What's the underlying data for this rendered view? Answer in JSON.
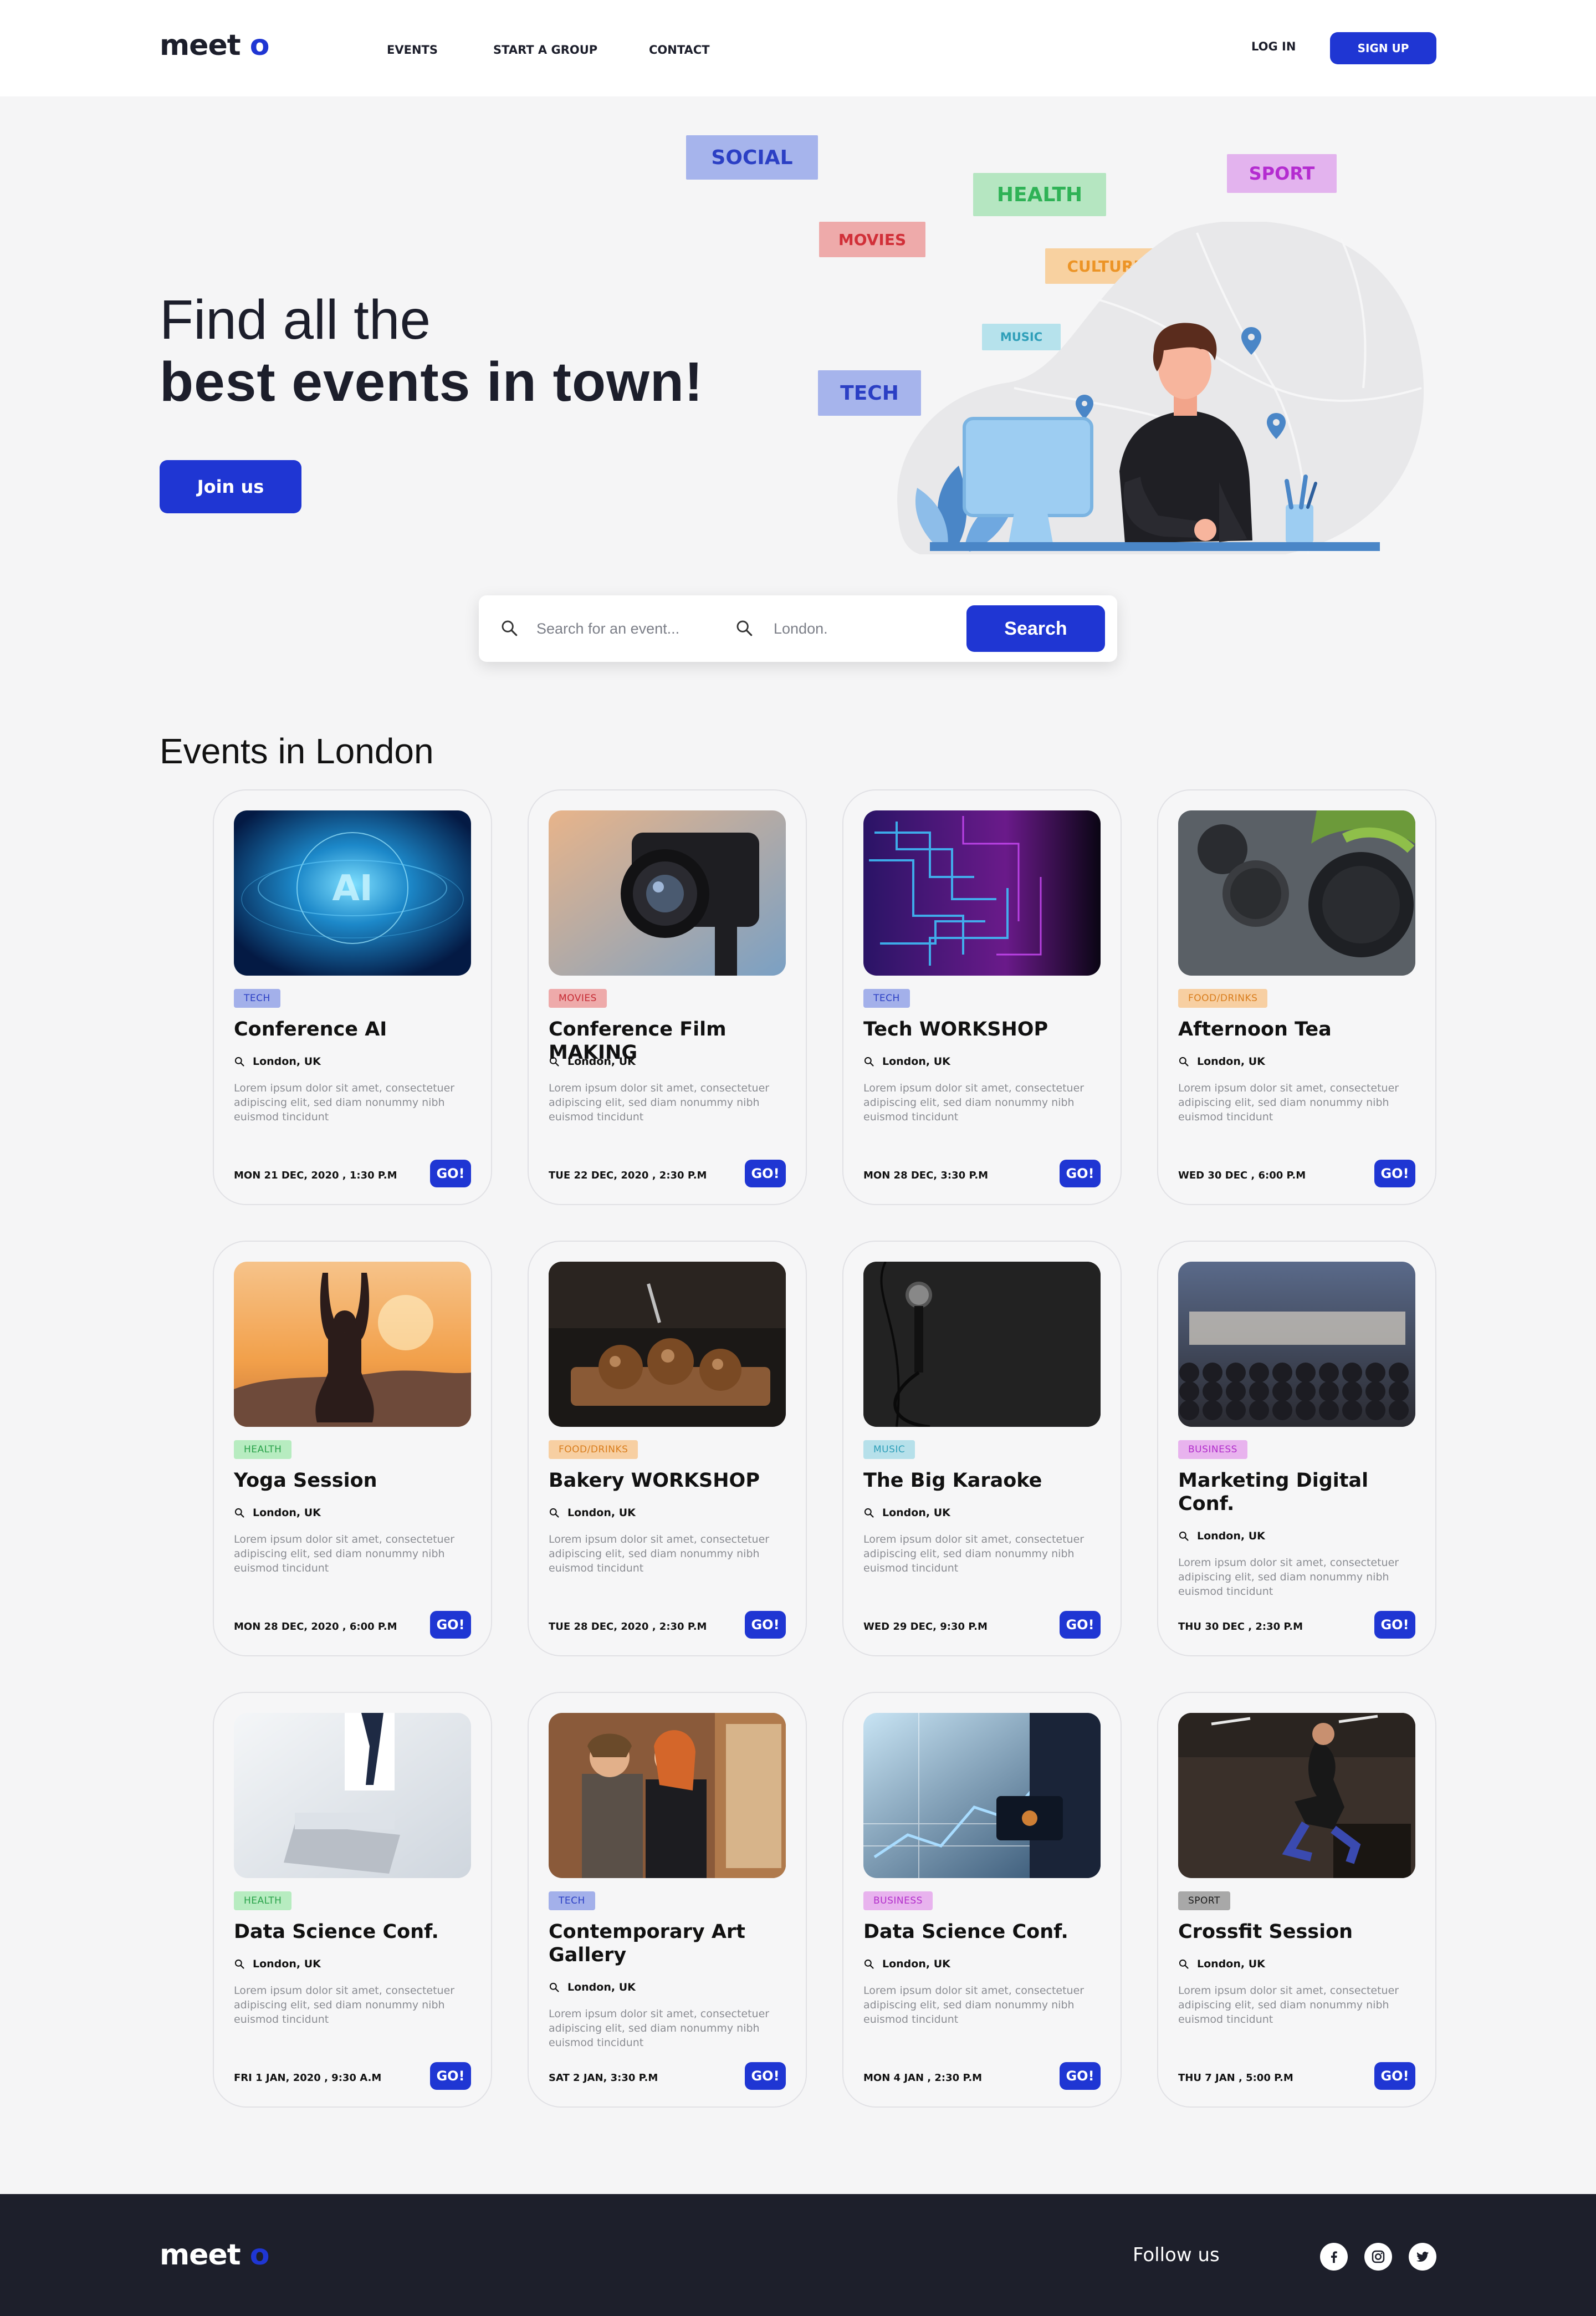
{
  "header": {
    "logo_text": "meet",
    "logo_accent": "o",
    "nav": [
      "EVENTS",
      "START A GROUP",
      "CONTACT"
    ],
    "login_label": "LOG IN",
    "signup_label": "SIGN UP"
  },
  "hero": {
    "line1": "Find all the",
    "line2": "best events in town!",
    "cta_label": "Join us",
    "floating_tags": [
      "SOCIAL",
      "HEALTH",
      "SPORT",
      "MOVIES",
      "CULTURE",
      "MUSIC",
      "TECH"
    ]
  },
  "search": {
    "event_placeholder": "Search for an event...",
    "location_placeholder": "London.",
    "button_label": "Search"
  },
  "events_title": "Events in London",
  "events": [
    {
      "tag": "TECH",
      "title": "Conference AI",
      "location": "London, UK",
      "description": "Lorem ipsum dolor sit amet, consectetuer adipiscing elit, sed diam nonummy nibh euismod tincidunt",
      "date": "MON 21 DEC, 2020 , 1:30 P.M",
      "go_label": "GO!"
    },
    {
      "tag": "MOVIES",
      "title": "Conference Film MAKING",
      "location": "London, UK",
      "description": "Lorem ipsum dolor sit amet, consectetuer adipiscing elit, sed diam nonummy nibh euismod tincidunt",
      "date": "TUE 22 DEC, 2020 , 2:30 P.M",
      "go_label": "GO!"
    },
    {
      "tag": "TECH",
      "title": "Tech WORKSHOP",
      "location": "London, UK",
      "description": "Lorem ipsum dolor sit amet, consectetuer adipiscing elit, sed diam nonummy nibh euismod tincidunt",
      "date": "MON 28 DEC, 3:30 P.M",
      "go_label": "GO!"
    },
    {
      "tag": "FOOD/DRINKS",
      "title": "Afternoon Tea",
      "location": "London, UK",
      "description": "Lorem ipsum dolor sit amet, consectetuer adipiscing elit, sed diam nonummy nibh euismod tincidunt",
      "date": "WED 30 DEC , 6:00 P.M",
      "go_label": "GO!"
    },
    {
      "tag": "HEALTH",
      "title": "Yoga Session",
      "location": "London, UK",
      "description": "Lorem ipsum dolor sit amet, consectetuer adipiscing elit, sed diam nonummy nibh euismod tincidunt",
      "date": "MON 28 DEC, 2020 , 6:00 P.M",
      "go_label": "GO!"
    },
    {
      "tag": "FOOD/DRINKS",
      "title": "Bakery WORKSHOP",
      "location": "London, UK",
      "description": "Lorem ipsum dolor sit amet, consectetuer adipiscing elit, sed diam nonummy nibh euismod tincidunt",
      "date": "TUE 28 DEC, 2020 , 2:30 P.M",
      "go_label": "GO!"
    },
    {
      "tag": "MUSIC",
      "title": "The Big Karaoke",
      "location": "London, UK",
      "description": "Lorem ipsum dolor sit amet, consectetuer adipiscing elit, sed diam nonummy nibh euismod tincidunt",
      "date": "WED 29 DEC, 9:30 P.M",
      "go_label": "GO!"
    },
    {
      "tag": "BUSINESS",
      "title": "Marketing Digital Conf.",
      "location": "London, UK",
      "description": "Lorem ipsum dolor sit amet, consectetuer adipiscing elit, sed diam nonummy nibh euismod tincidunt",
      "date": "THU 30 DEC , 2:30 P.M",
      "go_label": "GO!"
    },
    {
      "tag": "HEALTH",
      "title": "Data Science Conf.",
      "location": "London, UK",
      "description": "Lorem ipsum dolor sit amet, consectetuer adipiscing elit, sed diam nonummy nibh euismod tincidunt",
      "date": "FRI 1 JAN, 2020 , 9:30 A.M",
      "go_label": "GO!"
    },
    {
      "tag": "TECH",
      "title": "Contemporary Art Gallery",
      "location": "London, UK",
      "description": "Lorem ipsum dolor sit amet, consectetuer adipiscing elit, sed diam nonummy nibh euismod tincidunt",
      "date": "SAT 2 JAN, 3:30 P.M",
      "go_label": "GO!"
    },
    {
      "tag": "BUSINESS",
      "title": "Data Science Conf.",
      "location": "London, UK",
      "description": "Lorem ipsum dolor sit amet, consectetuer adipiscing elit, sed diam nonummy nibh euismod tincidunt",
      "date": "MON 4 JAN , 2:30 P.M",
      "go_label": "GO!"
    },
    {
      "tag": "SPORT",
      "title": "Crossfit Session",
      "location": "London, UK",
      "description": "Lorem ipsum dolor sit amet, consectetuer adipiscing elit, sed diam nonummy nibh euismod tincidunt",
      "date": "THU 7 JAN , 5:00 P.M",
      "go_label": "GO!"
    }
  ],
  "footer": {
    "logo_text": "meet",
    "logo_accent": "o",
    "follow_label": "Follow us",
    "social_icons": [
      "facebook-icon",
      "instagram-icon",
      "twitter-icon"
    ]
  },
  "colors": {
    "brand": "#1f36d3",
    "footer_bg": "#1d1f2b",
    "page_bg": "#f5f5f6"
  }
}
